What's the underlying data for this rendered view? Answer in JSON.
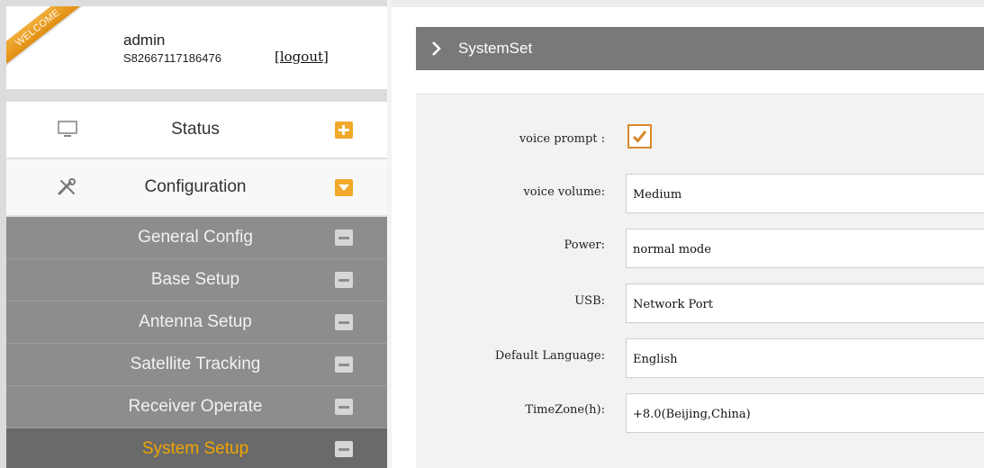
{
  "user": {
    "welcome": "WELCOME",
    "name": "admin",
    "serial": "S82667117186476",
    "logout_label": "[logout]"
  },
  "menu": {
    "main": [
      {
        "label": "Status",
        "icon": "monitor-icon",
        "expanded": false
      },
      {
        "label": "Configuration",
        "icon": "tools-icon",
        "expanded": true
      }
    ],
    "submenu": [
      {
        "label": "General Config",
        "active": false
      },
      {
        "label": "Base Setup",
        "active": false
      },
      {
        "label": "Antenna Setup",
        "active": false
      },
      {
        "label": "Satellite Tracking",
        "active": false
      },
      {
        "label": "Receiver Operate",
        "active": false
      },
      {
        "label": "System Setup",
        "active": true
      }
    ]
  },
  "section": {
    "title": "SystemSet"
  },
  "form": {
    "voice_prompt": {
      "label": "voice prompt :",
      "checked": true
    },
    "voice_volume": {
      "label": "voice volume:",
      "value": "Medium"
    },
    "power": {
      "label": "Power:",
      "value": "normal mode"
    },
    "usb": {
      "label": "USB:",
      "value": "Network Port"
    },
    "default_language": {
      "label": "Default Language:",
      "value": "English"
    },
    "timezone": {
      "label": "TimeZone(h):",
      "value": "+8.0(Beijing,China)"
    }
  },
  "colors": {
    "accent": "#f0a92a",
    "active_text": "#f0a500",
    "submenu_bg": "#8d8d8d",
    "header_bg": "#797979"
  }
}
